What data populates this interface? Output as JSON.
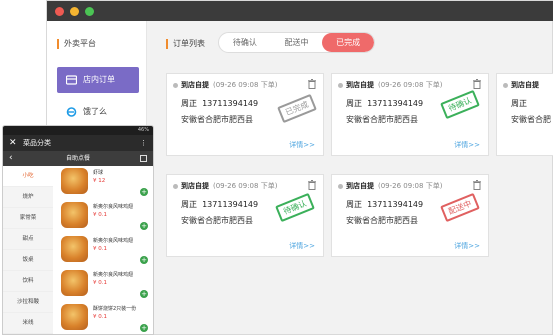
{
  "desktop": {
    "sidebar": {
      "title": "外卖平台",
      "items": [
        {
          "label": "店内订单",
          "active": true,
          "icon": "store-icon"
        },
        {
          "label": "饿了么",
          "active": false,
          "icon": "eleme-icon"
        }
      ]
    },
    "main": {
      "title": "订单列表",
      "tabs": [
        {
          "label": "待确认",
          "active": false
        },
        {
          "label": "配送中",
          "active": false
        },
        {
          "label": "已完成",
          "active": true
        }
      ],
      "cards": [
        {
          "type": "到店自提",
          "time": "(09-26 09:08 下单)",
          "name": "周正",
          "phone": "13711394149",
          "address": "安徽省合肥市肥西县",
          "detail": "详情>>",
          "stamp": "已完成",
          "stamp_color": "#9a9a9a"
        },
        {
          "type": "到店自提",
          "time": "(09-26 09:08 下单)",
          "name": "周正",
          "phone": "13711394149",
          "address": "安徽省合肥市肥西县",
          "detail": "详情>>",
          "stamp": "待确认",
          "stamp_color": "#3bb05a"
        },
        {
          "type": "到店自提",
          "time": "",
          "name": "周正",
          "phone": "",
          "address": "安徽省合肥",
          "detail": "",
          "stamp": "",
          "stamp_color": ""
        },
        {
          "type": "到店自提",
          "time": "(09-26 09:08 下单)",
          "name": "周正",
          "phone": "13711394149",
          "address": "安徽省合肥市肥西县",
          "detail": "详情>>",
          "stamp": "待确认",
          "stamp_color": "#3bb05a"
        },
        {
          "type": "到店自提",
          "time": "(09-26 09:08 下单)",
          "name": "周正",
          "phone": "13711394149",
          "address": "安徽省合肥市肥西县",
          "detail": "详情>>",
          "stamp": "配送中",
          "stamp_color": "#e06060"
        }
      ]
    }
  },
  "phone": {
    "status": "46%",
    "title": "菜品分类",
    "subtitle": "自助点餐",
    "categories": [
      "小吃",
      "烧炉",
      "家常菜",
      "甜点",
      "饭桌",
      "饮料",
      "沙拉和酸",
      "米线"
    ],
    "dishes": [
      {
        "name": "虾球",
        "price": "¥ 12"
      },
      {
        "name": "新奥尔良风味鸡翅",
        "price": "¥ 0.1"
      },
      {
        "name": "新奥尔良风味鸡翅",
        "price": "¥ 0.1"
      },
      {
        "name": "新奥尔良风味鸡翅",
        "price": "¥ 0.1"
      },
      {
        "name": "酥饼烧饼2只装一份",
        "price": "¥ 0.1"
      }
    ]
  }
}
